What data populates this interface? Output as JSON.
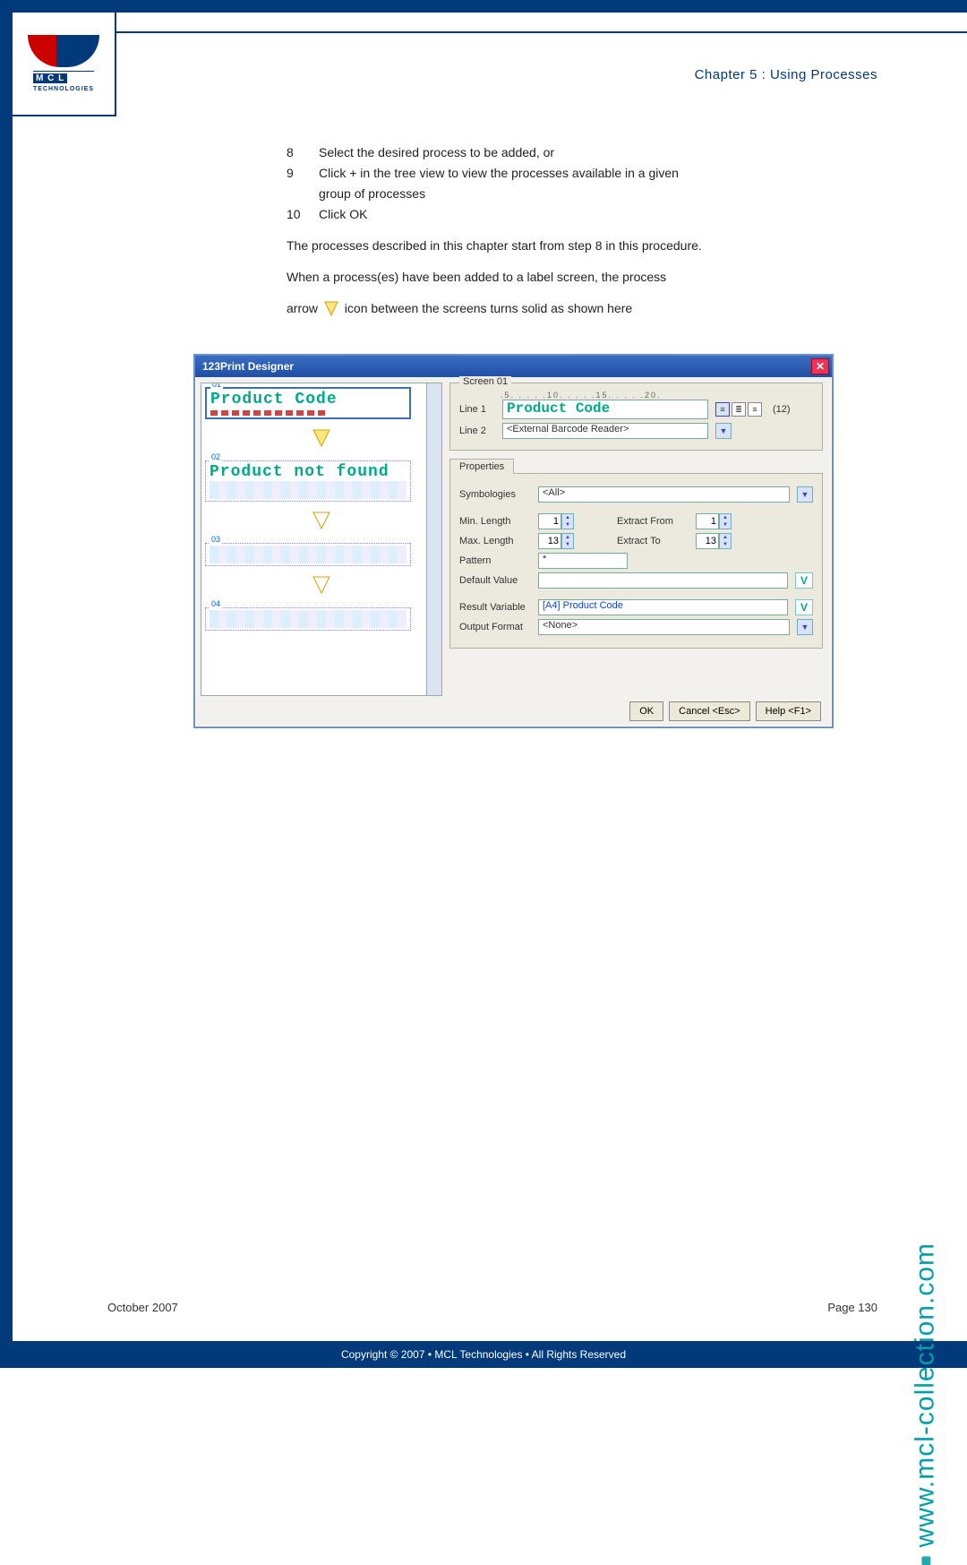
{
  "chapter_title": "Chapter 5 : Using Processes",
  "logo": {
    "line1": "M C L",
    "line2": "TECHNOLOGIES"
  },
  "steps": [
    {
      "n": "8",
      "t": "Select the desired process to be added, or"
    },
    {
      "n": "9",
      "t": "Click + in the tree view to view the processes available in a given"
    },
    {
      "n": "",
      "t": "group of processes"
    },
    {
      "n": "10",
      "t": "Click OK"
    }
  ],
  "para1": "The processes described in this chapter start from step 8 in this procedure.",
  "para2a": "When a process(es) have been added to a label screen, the process",
  "para2b_prefix": "arrow ",
  "para2b_suffix": " icon between the screens turns solid as shown here",
  "dialog": {
    "title": "123Print Designer",
    "screen_legend": "Screen 01",
    "ruler": ".5. . . . .10. . . . .15. . . . .20.",
    "line1_label": "Line 1",
    "line1_value": "Product Code",
    "align_count": "(12)",
    "line2_label": "Line 2",
    "line2_value": "<External Barcode Reader>",
    "tab": "Properties",
    "symb_label": "Symbologies",
    "symb_value": "<All>",
    "minlen_label": "Min. Length",
    "minlen_value": "1",
    "extfrom_label": "Extract From",
    "extfrom_value": "1",
    "maxlen_label": "Max. Length",
    "maxlen_value": "13",
    "extto_label": "Extract To",
    "extto_value": "13",
    "pattern_label": "Pattern",
    "pattern_value": "*",
    "defval_label": "Default Value",
    "defval_value": "",
    "resvar_label": "Result Variable",
    "resvar_value": "[A4] Product Code",
    "outfmt_label": "Output Format",
    "outfmt_value": "<None>",
    "ok": "OK",
    "cancel": "Cancel <Esc>",
    "help": "Help <F1>",
    "left": {
      "c01_num": "01",
      "c01_text": "Product Code",
      "c02_num": "02",
      "c02_text": "Product not found",
      "c03_num": "03",
      "c04_num": "04"
    }
  },
  "footer_date": "October 2007",
  "footer_page": "Page 130",
  "copyright": "Copyright © 2007 • MCL Technologies • All Rights Reserved",
  "side_url": "www.mcl-collection.com"
}
